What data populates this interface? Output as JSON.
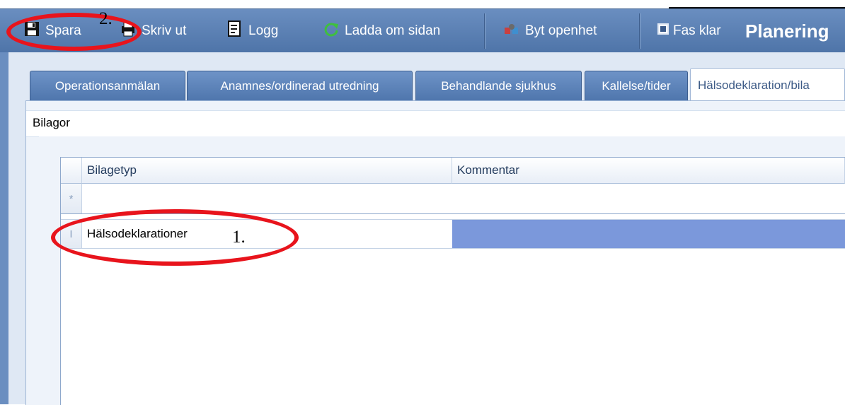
{
  "toolbar": {
    "save_label": "Spara",
    "print_label": "Skriv ut",
    "log_label": "Logg",
    "reload_label": "Ladda om sidan",
    "openness_label": "Byt openhet",
    "phase_done_label": "Fas klar",
    "title": "Planering"
  },
  "tabs": [
    {
      "label": "Operationsanmälan"
    },
    {
      "label": "Anamnes/ordinerad utredning"
    },
    {
      "label": "Behandlande sjukhus"
    },
    {
      "label": "Kallelse/tider"
    },
    {
      "label": "Hälsodeklaration/bila"
    }
  ],
  "group": {
    "label": "Bilagor"
  },
  "grid": {
    "columns": [
      "Bilagetyp",
      "Kommentar"
    ],
    "new_row_marker": "*",
    "rows": [
      {
        "marker": "I",
        "bilagetyp": "Hälsodeklarationer",
        "kommentar": ""
      }
    ]
  },
  "annotations": {
    "one": "1.",
    "two": "2."
  },
  "colors": {
    "toolbar": "#5b7fb4",
    "selection": "#7b98db",
    "annotation": "#e8141c"
  },
  "icons": {
    "save": "floppy-icon",
    "print": "printer-icon",
    "log": "log-icon",
    "reload": "refresh-icon",
    "openness": "openness-icon",
    "phase": "checkbox-icon"
  }
}
